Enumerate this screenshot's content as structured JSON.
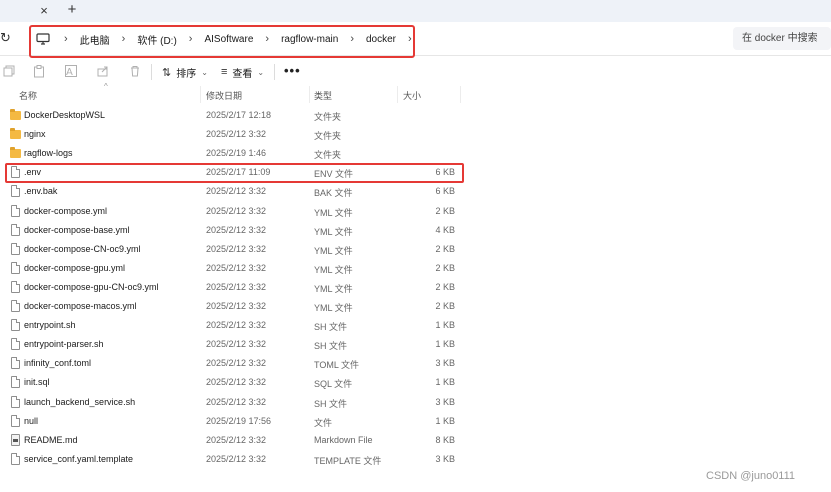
{
  "tabs": {
    "close_glyph": "×",
    "new_glyph": "+"
  },
  "nav": {
    "breadcrumb": [
      "此电脑",
      "软件 (D:)",
      "AISoftware",
      "ragflow-main",
      "docker"
    ],
    "search_placeholder": "在 docker 中搜索"
  },
  "toolbar": {
    "sort_label": "排序",
    "view_label": "查看",
    "more_label": "•••"
  },
  "columns": {
    "name": "名称",
    "modified": "修改日期",
    "type": "类型",
    "size": "大小"
  },
  "files": [
    {
      "name": "DockerDesktopWSL",
      "modified": "2025/2/17 12:18",
      "type": "文件夹",
      "size": "",
      "kind": "folder"
    },
    {
      "name": "nginx",
      "modified": "2025/2/12 3:32",
      "type": "文件夹",
      "size": "",
      "kind": "folder"
    },
    {
      "name": "ragflow-logs",
      "modified": "2025/2/19 1:46",
      "type": "文件夹",
      "size": "",
      "kind": "folder"
    },
    {
      "name": ".env",
      "modified": "2025/2/17 11:09",
      "type": "ENV 文件",
      "size": "6 KB",
      "kind": "file"
    },
    {
      "name": ".env.bak",
      "modified": "2025/2/12 3:32",
      "type": "BAK 文件",
      "size": "6 KB",
      "kind": "file"
    },
    {
      "name": "docker-compose.yml",
      "modified": "2025/2/12 3:32",
      "type": "YML 文件",
      "size": "2 KB",
      "kind": "file"
    },
    {
      "name": "docker-compose-base.yml",
      "modified": "2025/2/12 3:32",
      "type": "YML 文件",
      "size": "4 KB",
      "kind": "file"
    },
    {
      "name": "docker-compose-CN-oc9.yml",
      "modified": "2025/2/12 3:32",
      "type": "YML 文件",
      "size": "2 KB",
      "kind": "file"
    },
    {
      "name": "docker-compose-gpu.yml",
      "modified": "2025/2/12 3:32",
      "type": "YML 文件",
      "size": "2 KB",
      "kind": "file"
    },
    {
      "name": "docker-compose-gpu-CN-oc9.yml",
      "modified": "2025/2/12 3:32",
      "type": "YML 文件",
      "size": "2 KB",
      "kind": "file"
    },
    {
      "name": "docker-compose-macos.yml",
      "modified": "2025/2/12 3:32",
      "type": "YML 文件",
      "size": "2 KB",
      "kind": "file"
    },
    {
      "name": "entrypoint.sh",
      "modified": "2025/2/12 3:32",
      "type": "SH 文件",
      "size": "1 KB",
      "kind": "file"
    },
    {
      "name": "entrypoint-parser.sh",
      "modified": "2025/2/12 3:32",
      "type": "SH 文件",
      "size": "1 KB",
      "kind": "file"
    },
    {
      "name": "infinity_conf.toml",
      "modified": "2025/2/12 3:32",
      "type": "TOML 文件",
      "size": "3 KB",
      "kind": "file"
    },
    {
      "name": "init.sql",
      "modified": "2025/2/12 3:32",
      "type": "SQL 文件",
      "size": "1 KB",
      "kind": "file"
    },
    {
      "name": "launch_backend_service.sh",
      "modified": "2025/2/12 3:32",
      "type": "SH 文件",
      "size": "3 KB",
      "kind": "file"
    },
    {
      "name": "null",
      "modified": "2025/2/19 17:56",
      "type": "文件",
      "size": "1 KB",
      "kind": "file"
    },
    {
      "name": "README.md",
      "modified": "2025/2/12 3:32",
      "type": "Markdown File",
      "size": "8 KB",
      "kind": "markdown"
    },
    {
      "name": "service_conf.yaml.template",
      "modified": "2025/2/12 3:32",
      "type": "TEMPLATE 文件",
      "size": "3 KB",
      "kind": "file"
    }
  ],
  "watermark": "CSDN @juno0111",
  "colors": {
    "highlight": "#e53935",
    "folder": "#f4b942"
  }
}
